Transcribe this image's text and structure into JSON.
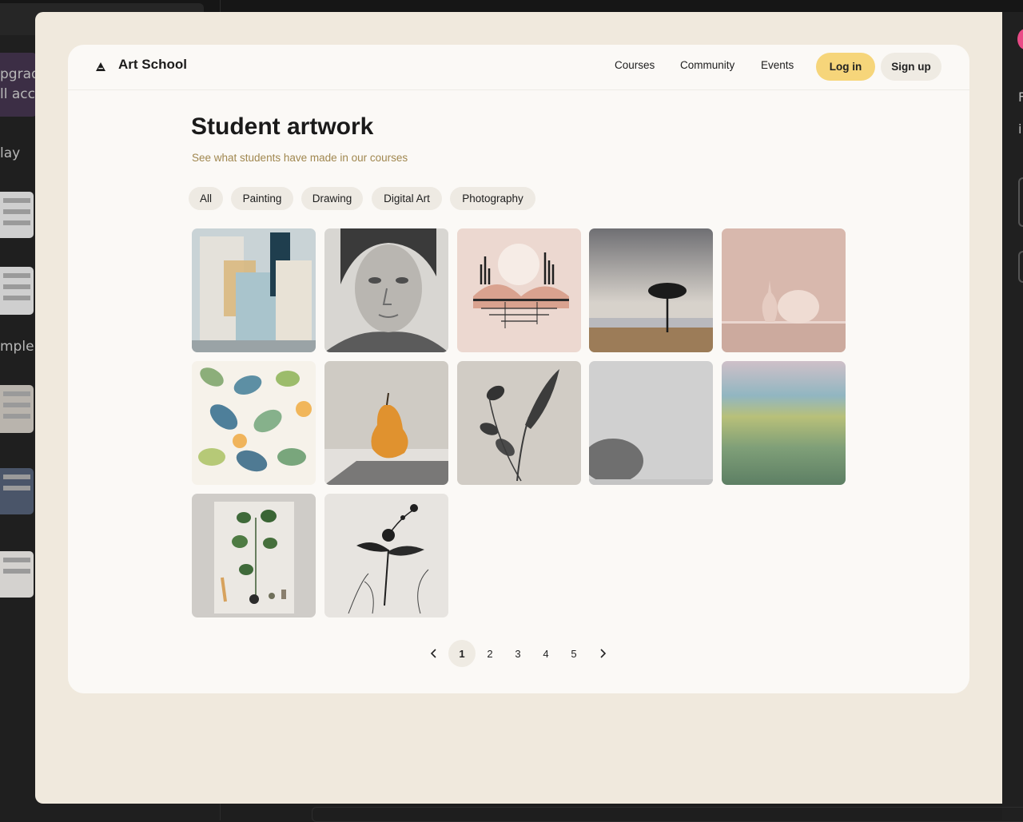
{
  "background": {
    "left_sidebar": {
      "upgrade_line1": "pgrad",
      "upgrade_line2": "ll acc",
      "day_label": "lay",
      "sample_label": "mple"
    },
    "right_panel": {
      "letter1": "F",
      "letter2": "i"
    }
  },
  "nav": {
    "logo_text": "Art School",
    "links": [
      "Courses",
      "Community",
      "Events"
    ],
    "login_label": "Log in",
    "signup_label": "Sign up"
  },
  "header": {
    "title": "Student artwork",
    "subtitle": "See what students have made in our courses"
  },
  "filters": [
    "All",
    "Painting",
    "Drawing",
    "Digital Art",
    "Photography"
  ],
  "gallery": {
    "images": [
      "abstract-blue-painting",
      "pencil-portrait",
      "pink-landscape-illustration",
      "lone-tree-landscape",
      "pink-still-life-vases",
      "watercolor-leaves-pattern",
      "pear-still-life",
      "leaf-silhouette",
      "misty-tree",
      "green-meadow-painting",
      "pressed-plant-collage",
      "ink-flower-drawing"
    ]
  },
  "pagination": {
    "pages": [
      "1",
      "2",
      "3",
      "4",
      "5"
    ],
    "current": "1",
    "prev_icon": "chevron-left-icon",
    "next_icon": "chevron-right-icon"
  },
  "colors": {
    "accent": "#f6d57a",
    "modal_bg": "#f0e9dd",
    "card_bg": "#fbf9f6",
    "subtitle": "#a0874f"
  }
}
